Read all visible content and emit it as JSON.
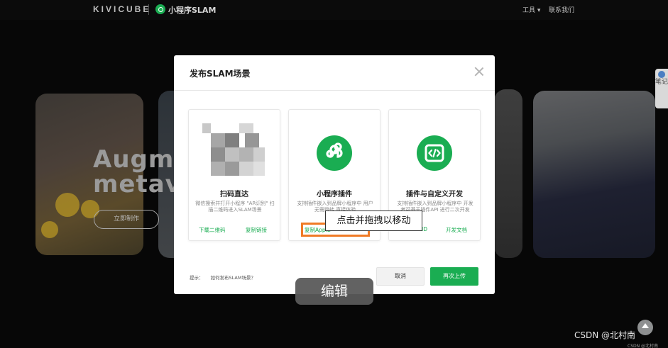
{
  "header": {
    "brand": "KIVICUBE",
    "product_title": "小程序SLAM",
    "nav_tools": "工具",
    "nav_contact": "联系我们"
  },
  "background": {
    "hero_line1": "Augme",
    "hero_line2": "metav",
    "create_button": "立即制作",
    "side_note": "笔记",
    "csdn_watermark": "CSDN @北村南",
    "csdn_small": "CSDN @北村南"
  },
  "modal": {
    "title": "发布SLAM场景",
    "options": [
      {
        "title": "扫码直达",
        "desc": "微信搜索并打开小程序 \"AR识别\" 扫描二维码进入SLAM场景",
        "links": [
          "下载二维码",
          "复制链接"
        ]
      },
      {
        "title": "小程序插件",
        "desc": "支持插件嵌入到品牌小程序中 用户无需跳转 直接体验",
        "links": [
          "复制AppID"
        ]
      },
      {
        "title": "插件与自定义开发",
        "desc": "支持插件嵌入到品牌小程序中 开发者可基于插件API 进行二次开发",
        "links": [
          "ID",
          "开发文档"
        ]
      }
    ],
    "footer_tip_label": "提示：",
    "footer_tip_question": "如何发布SLAM场景？",
    "cancel_button": "取消",
    "upload_button": "再次上传"
  },
  "overlay": {
    "drag_tip": "点击并拖拽以移动",
    "edit_label": "编辑"
  },
  "colors": {
    "accent_green": "#1aad52",
    "highlight_orange": "#f07b26"
  }
}
